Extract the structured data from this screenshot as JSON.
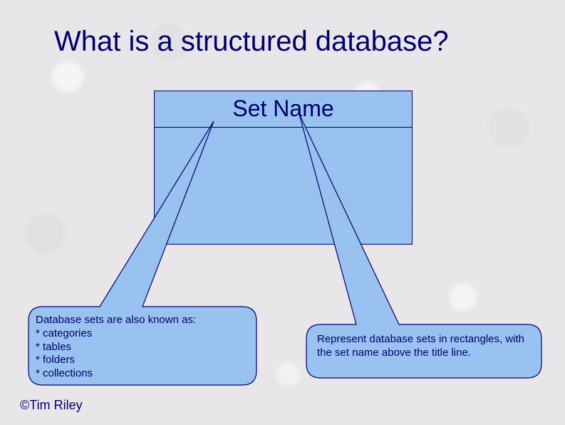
{
  "title": "What is a structured database?",
  "set_box": {
    "label": "Set Name"
  },
  "callouts": {
    "left": {
      "intro": "Database sets are also known as:",
      "bullets": [
        "* categories",
        "* tables",
        "* folders",
        "* collections"
      ]
    },
    "right": {
      "text": "Represent database sets in rectangles, with the set name above the title line."
    }
  },
  "copyright": "©Tim Riley",
  "colors": {
    "accent": "#00006b",
    "box_fill": "#99c2f0"
  }
}
